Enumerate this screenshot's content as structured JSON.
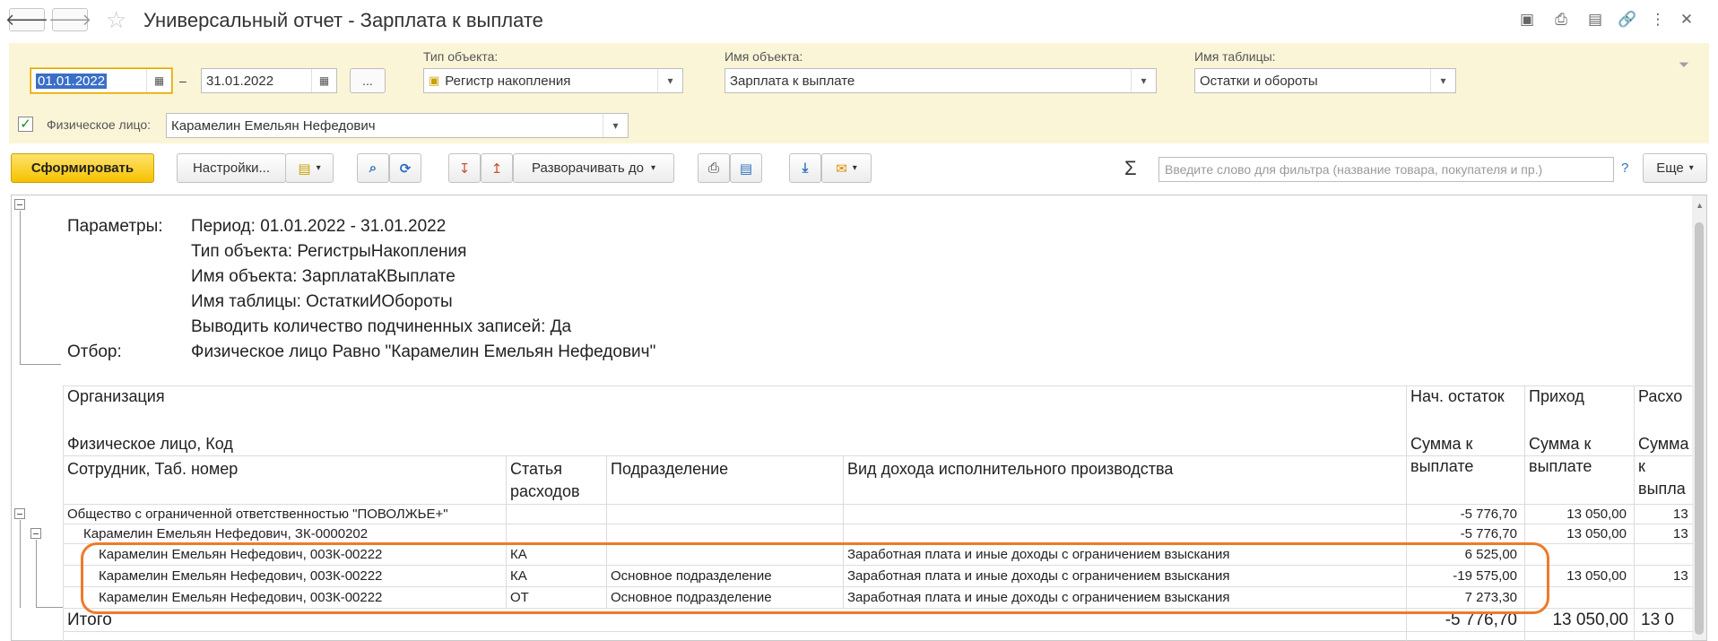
{
  "window": {
    "title": "Универсальный отчет - Зарплата к выплате",
    "back_glyph": "🡐",
    "forward_glyph": "🡒"
  },
  "filters": {
    "date_from": "01.01.2022",
    "date_dash": "–",
    "date_to": "31.01.2022",
    "period_button": "...",
    "object_type_label": "Тип объекта:",
    "object_type_value": "Регистр накопления",
    "object_name_label": "Имя объекта:",
    "object_name_value": "Зарплата к выплате",
    "table_name_label": "Имя таблицы:",
    "table_name_value": "Остатки и обороты",
    "person_label": "Физическое лицо:",
    "person_value": "Карамелин Емельян Нефедович",
    "person_checked": true
  },
  "toolbar": {
    "generate_label": "Сформировать",
    "settings_label": "Настройки...",
    "expand_label": "Разворачивать до",
    "filter_placeholder": "Введите слово для фильтра (название товара, покупателя и пр.)",
    "help_label": "?",
    "more_label": "Еще",
    "sigma_label": "Σ"
  },
  "report": {
    "params_label": "Параметры:",
    "params": [
      "Период: 01.01.2022 - 31.01.2022",
      "Тип объекта: РегистрыНакопления",
      "Имя объекта: ЗарплатаКВыплате",
      "Имя таблицы: ОстаткиИОбороты",
      "Выводить количество подчиненных записей: Да"
    ],
    "filter_label": "Отбор:",
    "filter_value": "Физическое лицо Равно \"Карамелин Емельян Нефедович\"",
    "headers": {
      "org": "Организация",
      "person_code": "Физическое лицо, Код",
      "employee": "Сотрудник, Таб. номер",
      "article": "Статья расходов",
      "division": "Подразделение",
      "income_type": "Вид дохода исполнительного производства",
      "start_balance": "Нач. остаток",
      "start_balance_sub": "Сумма к выплате",
      "income": "Приход",
      "income_sub": "Сумма к выплате",
      "expense": "Расхо",
      "expense_sub": "Сумма к выпла"
    },
    "rows": [
      {
        "name": "Общество с ограниченной ответственностью \"ПОВОЛЖЬЕ+\"",
        "article": "",
        "division": "",
        "income_type": "",
        "start": "-5 776,70",
        "income": "13 050,00",
        "expense": "13"
      },
      {
        "name": "Карамелин Емельян Нефедович, ЗК-0000202",
        "article": "",
        "division": "",
        "income_type": "",
        "start": "-5 776,70",
        "income": "13 050,00",
        "expense": "13"
      },
      {
        "name": "Карамелин Емельян Нефедович, 003К-00222",
        "article": "КА",
        "division": "",
        "income_type": "Заработная плата и иные доходы с ограничением взыскания",
        "start": "6 525,00",
        "income": "",
        "expense": ""
      },
      {
        "name": "Карамелин Емельян Нефедович, 003К-00222",
        "article": "КА",
        "division": "Основное подразделение",
        "income_type": "Заработная плата и иные доходы с ограничением взыскания",
        "start": "-19 575,00",
        "income": "13 050,00",
        "expense": "13"
      },
      {
        "name": "Карамелин Емельян Нефедович, 003К-00222",
        "article": "ОТ",
        "division": "Основное подразделение",
        "income_type": "Заработная плата и иные доходы с ограничением взыскания",
        "start": "7 273,30",
        "income": "",
        "expense": ""
      }
    ],
    "total": {
      "label": "Итого",
      "start": "-5 776,70",
      "income": "13 050,00",
      "expense": "13 0"
    }
  }
}
